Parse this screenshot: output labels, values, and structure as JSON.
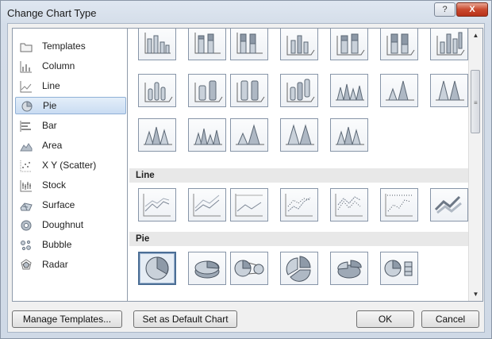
{
  "window": {
    "title": "Change Chart Type",
    "help_label": "?",
    "close_label": "X"
  },
  "chart_types": [
    {
      "label": "Templates",
      "icon": "folder-icon"
    },
    {
      "label": "Column",
      "icon": "column-chart-icon"
    },
    {
      "label": "Line",
      "icon": "line-chart-icon"
    },
    {
      "label": "Pie",
      "icon": "pie-chart-icon",
      "selected": true
    },
    {
      "label": "Bar",
      "icon": "bar-chart-icon"
    },
    {
      "label": "Area",
      "icon": "area-chart-icon"
    },
    {
      "label": "X Y (Scatter)",
      "icon": "scatter-chart-icon"
    },
    {
      "label": "Stock",
      "icon": "stock-chart-icon"
    },
    {
      "label": "Surface",
      "icon": "surface-chart-icon"
    },
    {
      "label": "Doughnut",
      "icon": "doughnut-chart-icon"
    },
    {
      "label": "Bubble",
      "icon": "bubble-chart-icon"
    },
    {
      "label": "Radar",
      "icon": "radar-chart-icon"
    }
  ],
  "gallery": {
    "sections": {
      "line": "Line",
      "pie": "Pie"
    }
  },
  "buttons": {
    "manage_templates": "Manage Templates...",
    "set_default": "Set as Default Chart",
    "ok": "OK",
    "cancel": "Cancel"
  }
}
